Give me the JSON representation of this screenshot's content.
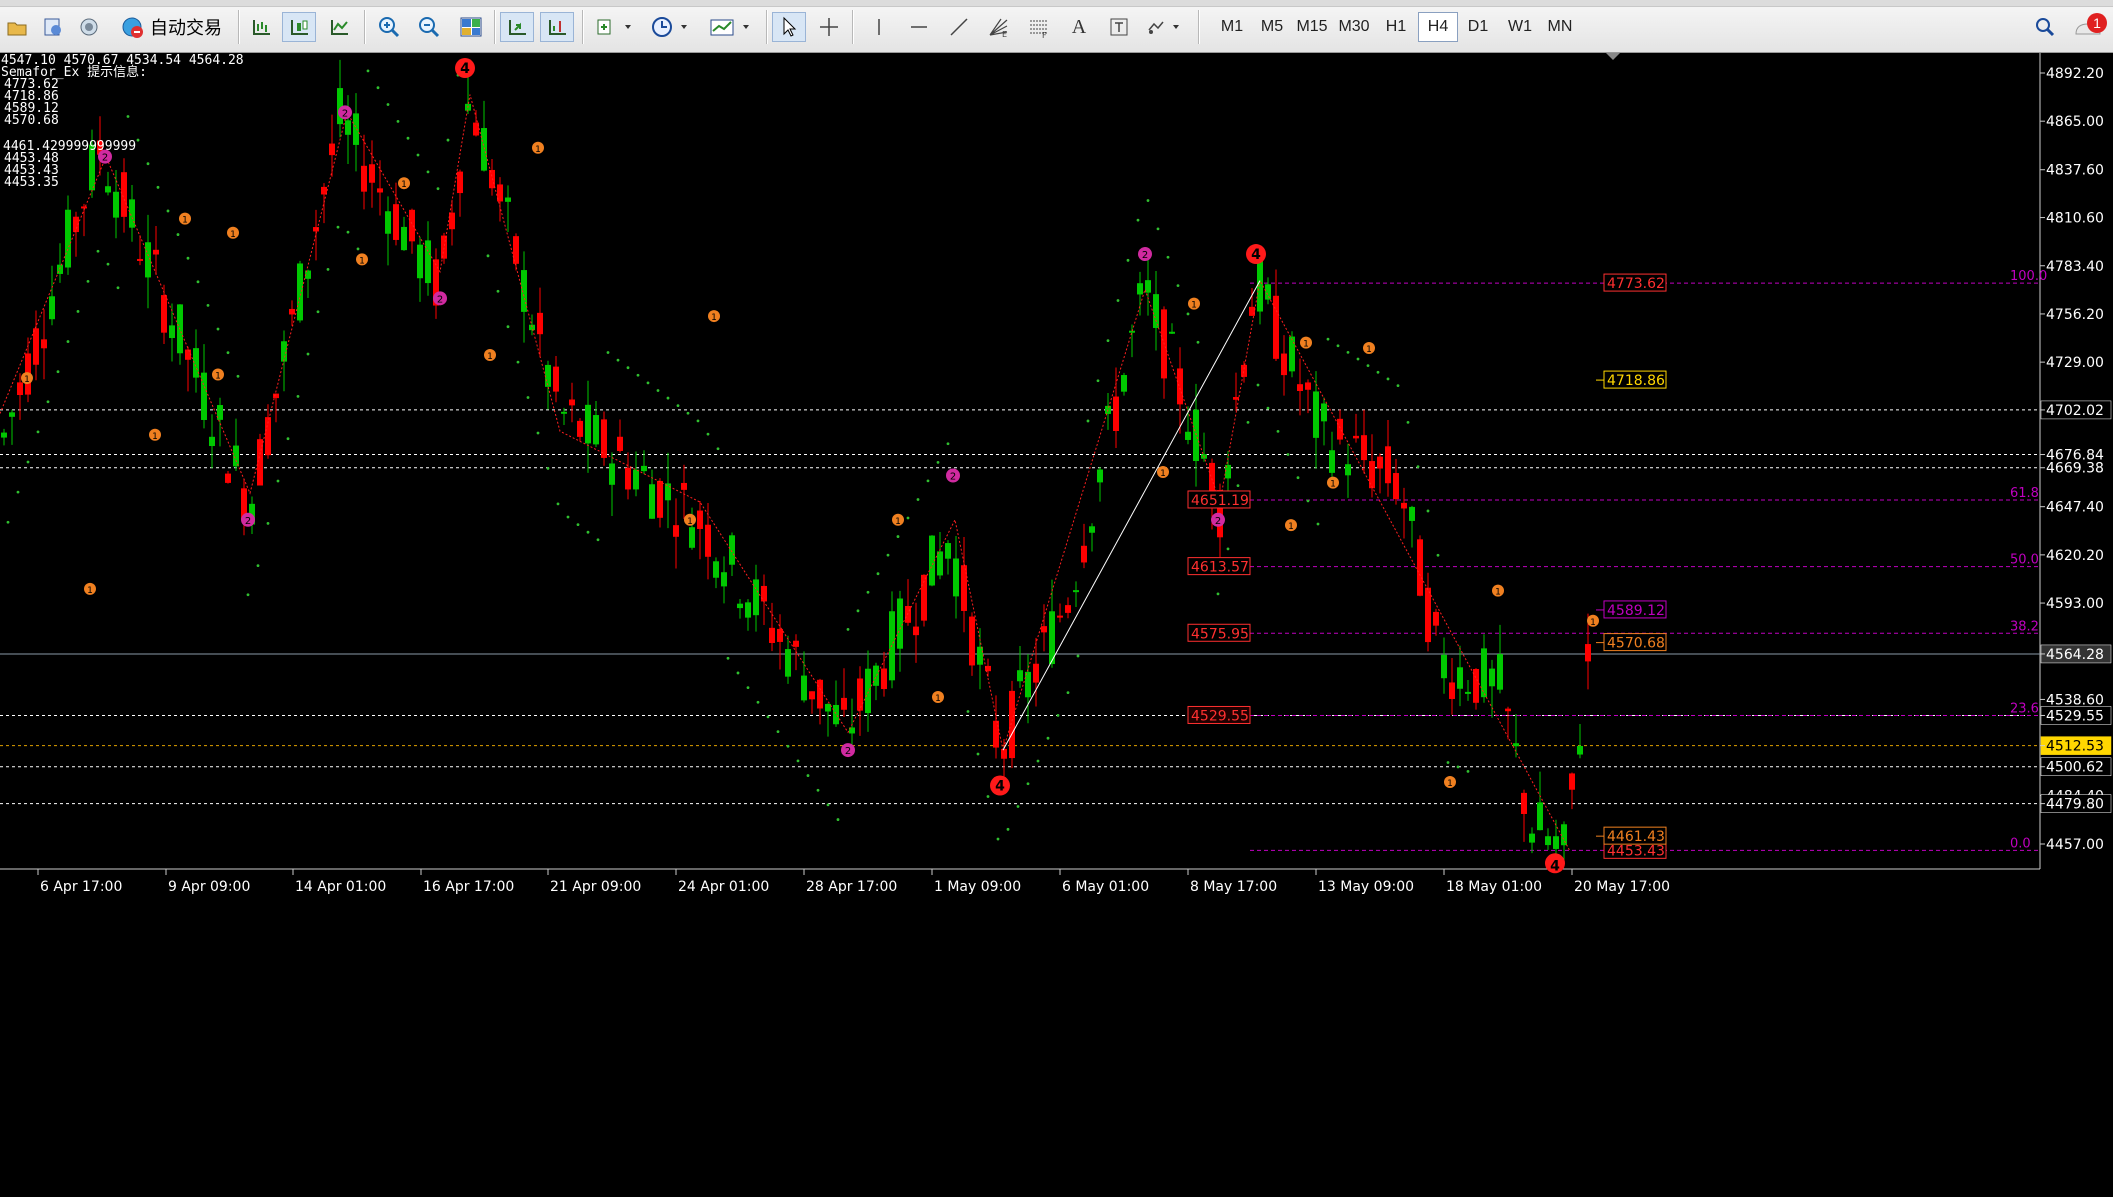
{
  "toolbar": {
    "auto_trading_label": "自动交易",
    "icons": [
      "folder-icon",
      "profile-icon",
      "globe-icon",
      "auto-trading-icon",
      "bar-chart-icon",
      "candles-icon",
      "line-chart-icon",
      "zoom-in-icon",
      "zoom-out-icon",
      "tile-icon",
      "autoscroll-icon",
      "chart-shift-icon",
      "indicators-icon",
      "periods-icon",
      "templates-icon",
      "cursor-icon",
      "crosshair-icon",
      "vertical-line-icon",
      "horizontal-line-icon",
      "trendline-icon",
      "gann-icon",
      "fibo-icon",
      "text-icon",
      "label-icon",
      "shapes-icon",
      "search-icon",
      "notification-icon"
    ],
    "timeframes": [
      "M1",
      "M5",
      "M15",
      "M30",
      "H1",
      "H4",
      "D1",
      "W1",
      "MN"
    ],
    "active_timeframe": "H4",
    "notification_count": "1"
  },
  "chart": {
    "ohlc_line": "4547.10 4570.67 4534.54 4564.28",
    "indicator_name": "Semafor_Ex 提示信息:",
    "indicator_values": [
      "4773.62",
      "4718.86",
      "4589.12",
      "4570.68",
      "",
      "4461.429999999999",
      "4453.48",
      "4453.43",
      "4453.35"
    ],
    "price_axis": [
      "4892.20",
      "4865.00",
      "4837.60",
      "4810.60",
      "4783.40",
      "4756.20",
      "4729.00",
      "4702.02",
      "4676.84",
      "4669.38",
      "4647.40",
      "4620.20",
      "4593.00",
      "4564.28",
      "4538.60",
      "4529.55",
      "4512.53",
      "4500.62",
      "4484.40",
      "4479.80",
      "4457.00"
    ],
    "time_axis": [
      "6 Apr 17:00",
      "9 Apr 09:00",
      "14 Apr 01:00",
      "16 Apr 17:00",
      "21 Apr 09:00",
      "24 Apr 01:00",
      "28 Apr 17:00",
      "1 May 09:00",
      "6 May 01:00",
      "8 May 17:00",
      "13 May 09:00",
      "18 May 01:00",
      "20 May 17:00"
    ],
    "fib_levels": [
      "100.0",
      "61.8",
      "50.0",
      "38.2",
      "23.6",
      "0.0"
    ],
    "fib_prices": [
      "4773.62",
      "4651.19",
      "4613.57",
      "4575.95",
      "4529.55",
      "4453.43"
    ],
    "labels_right": [
      "4718.86",
      "4589.12",
      "4570.68",
      "4461.43"
    ],
    "semafor_big": [
      "4",
      "4",
      "4",
      "4"
    ],
    "semafor_mid": [
      "2",
      "2",
      "2",
      "2",
      "2",
      "2",
      "2"
    ],
    "semafor_small": [
      "1"
    ],
    "colors": {
      "bull": "#00c800",
      "bear": "#ff0000",
      "fib": "#c000c0",
      "grid": "#ffffff",
      "gold": "#ffd700"
    }
  }
}
